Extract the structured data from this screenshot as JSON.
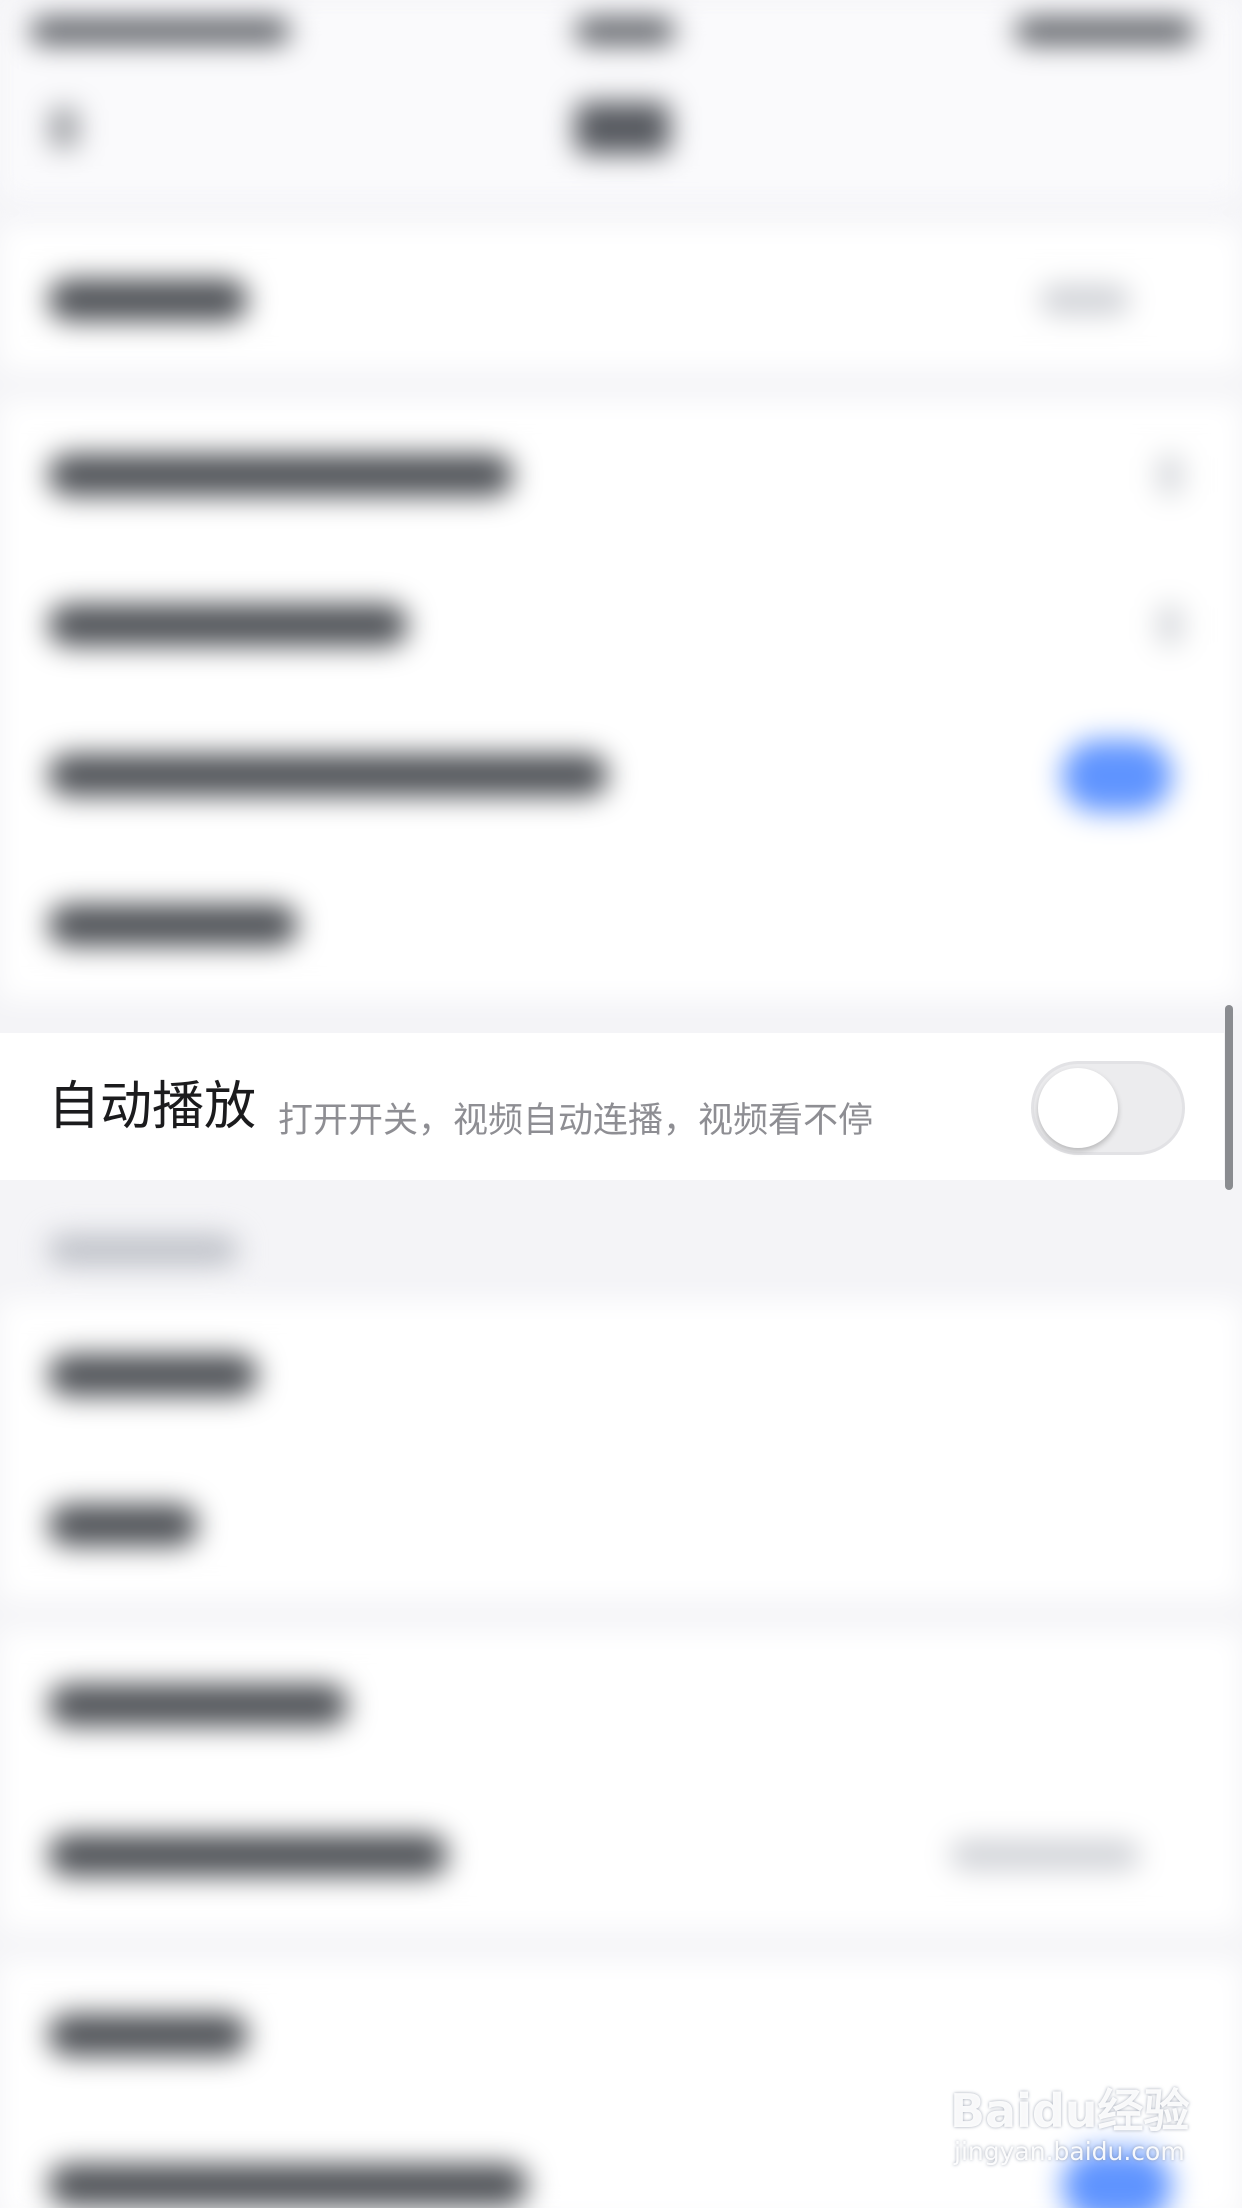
{
  "autoplay_row": {
    "title": "自动播放",
    "description": "打开开关，视频自动连播，视频看不停",
    "toggle_state": "off"
  },
  "watermark": {
    "brand": "Baidu经验",
    "url": "jingyan.baidu.com"
  },
  "colors": {
    "accent_blue": "#5f94ff",
    "background": "#f4f4f7",
    "row_background": "#ffffff",
    "title_text": "#1b1b1d",
    "secondary_text": "#8e8e93",
    "toggle_off": "#ececee"
  }
}
